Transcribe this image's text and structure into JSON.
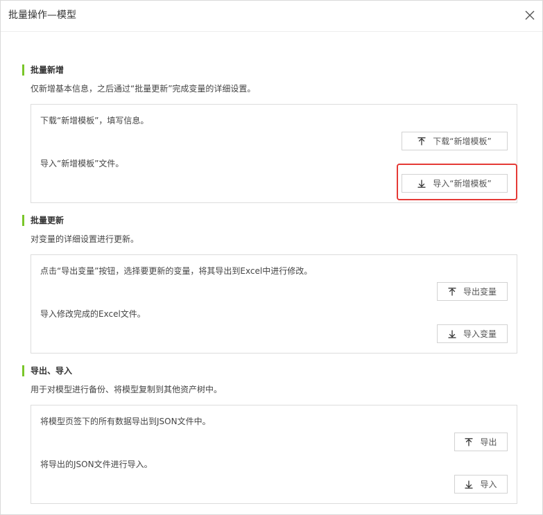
{
  "dialog": {
    "title": "批量操作—模型"
  },
  "sections": [
    {
      "heading": "批量新增",
      "description": "仅新增基本信息，之后通过“批量更新”完成变量的详细设置。",
      "rows": [
        {
          "text": "下载“新增模板”，填写信息。",
          "button_label": "下载“新增模板”",
          "button_icon": "arrow-up-bar-icon"
        },
        {
          "text": "导入“新增模板”文件。",
          "button_label": "导入“新增模板”",
          "button_icon": "arrow-down-bar-icon"
        }
      ]
    },
    {
      "heading": "批量更新",
      "description": "对变量的详细设置进行更新。",
      "rows": [
        {
          "text": "点击“导出变量”按钮，选择要更新的变量，将其导出到Excel中进行修改。",
          "button_label": "导出变量",
          "button_icon": "arrow-up-bar-icon"
        },
        {
          "text": "导入修改完成的Excel文件。",
          "button_label": "导入变量",
          "button_icon": "arrow-down-bar-icon"
        }
      ]
    },
    {
      "heading": "导出、导入",
      "description": "用于对模型进行备份、将模型复制到其他资产树中。",
      "rows": [
        {
          "text": "将模型页签下的所有数据导出到JSON文件中。",
          "button_label": "导出",
          "button_icon": "arrow-up-bar-icon"
        },
        {
          "text": "将导出的JSON文件进行导入。",
          "button_label": "导入",
          "button_icon": "arrow-down-bar-icon"
        }
      ]
    }
  ],
  "colors": {
    "accent": "#7ac62a",
    "highlight": "#e53935",
    "border": "#dcdcdc"
  }
}
